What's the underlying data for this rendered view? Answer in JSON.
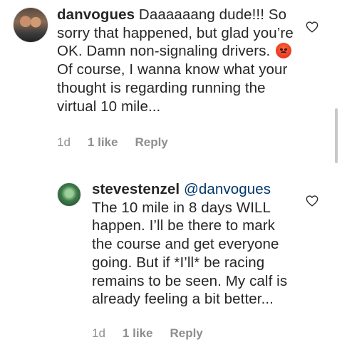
{
  "comments": [
    {
      "username": "danvogues",
      "text_before_emoji": " Daaaaaang dude!!! So sorry that happened, but glad you’re OK. Damn non-signaling drivers. ",
      "emoji": "angry-face-emoji",
      "text_after_emoji": " Of course, I wanna know what your thought is regarding running the virtual 10 mile...",
      "time": "1d",
      "likes": "1 like",
      "reply_label": "Reply"
    },
    {
      "username": "stevestenzel",
      "mention": "@danvogues",
      "text": " The 10 mile in 8 days WILL happen. I’ll be there to mark the course and get everyone going. But if *I’ll* be racing remains to be seen. My calf is already feeling a bit better...",
      "time": "1d",
      "likes": "1 like",
      "reply_label": "Reply"
    }
  ],
  "icons": {
    "like": "heart-outline-icon",
    "avatar1": "user-avatar",
    "avatar2": "user-avatar"
  },
  "colors": {
    "text": "#262626",
    "meta": "#8e8e8e",
    "mention": "#00376b",
    "background": "#ffffff"
  }
}
